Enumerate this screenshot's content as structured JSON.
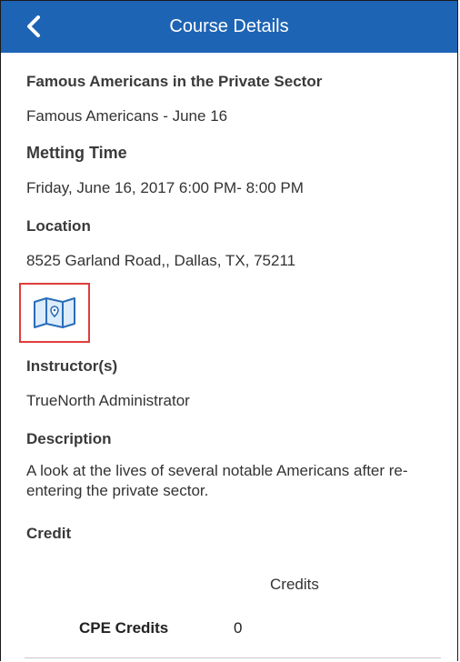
{
  "header": {
    "title": "Course Details",
    "bg_color": "#1e64b5",
    "back_icon": "chevron-left-icon"
  },
  "course": {
    "title": "Famous Americans in the Private Sector",
    "subtitle": "Famous Americans - June 16"
  },
  "meeting": {
    "label": "Metting Time",
    "value": "Friday, June 16, 2017  6:00 PM- 8:00 PM"
  },
  "location": {
    "label": "Location",
    "value": "8525 Garland Road,, Dallas, TX, 75211",
    "map_icon": "map-icon",
    "highlight_color": "#e03c3c"
  },
  "instructors": {
    "label": "Instructor(s)",
    "value": "TrueNorth Administrator"
  },
  "description": {
    "label": "Description",
    "value": "A look at the lives of several notable Americans after re-entering the private sector."
  },
  "credit": {
    "label": "Credit",
    "column_header": "Credits",
    "rows": [
      {
        "name": "CPE Credits",
        "value": "0"
      }
    ]
  }
}
